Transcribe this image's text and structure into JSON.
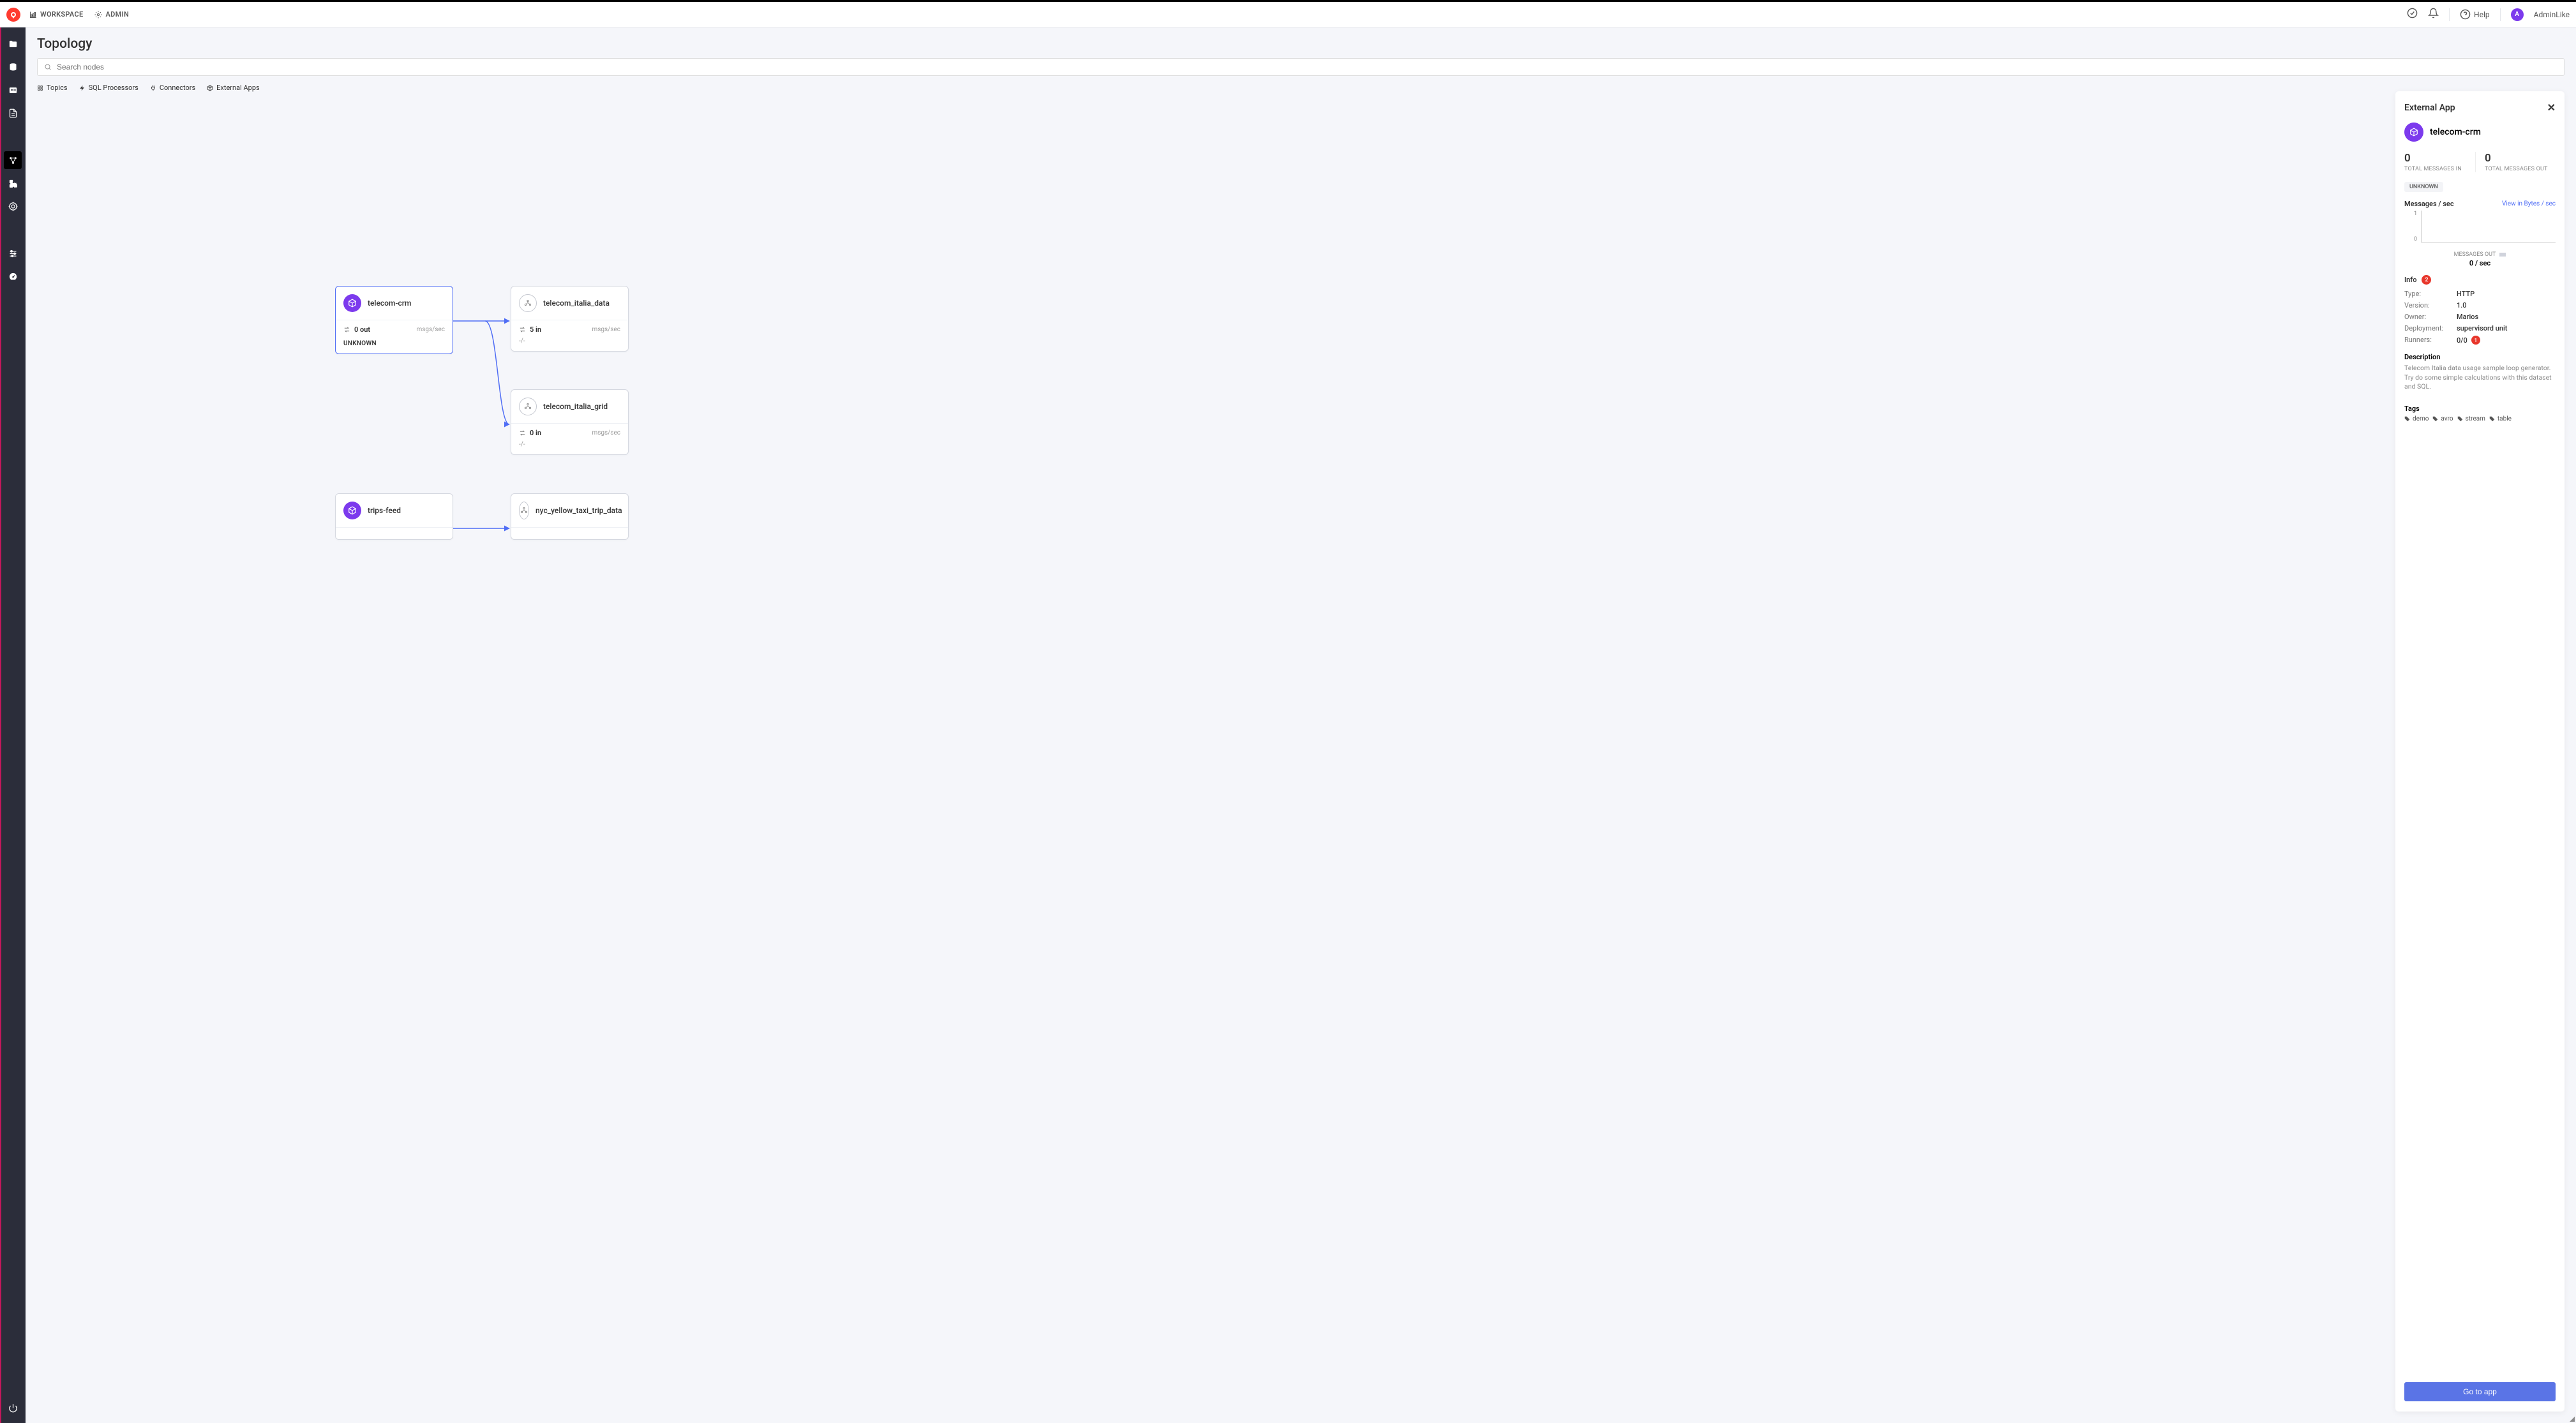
{
  "topnav": {
    "workspace_label": "WORKSPACE",
    "admin_label": "ADMIN",
    "help_label": "Help",
    "user_initial": "A",
    "user_name": "AdminLike"
  },
  "page": {
    "title": "Topology",
    "search_placeholder": "Search nodes"
  },
  "filters": {
    "topics": "Topics",
    "sql": "SQL Processors",
    "connectors": "Connectors",
    "external": "External Apps"
  },
  "nodes": {
    "n1": {
      "title": "telecom-crm",
      "flow": "0 out",
      "rate": "msgs/sec",
      "status": "UNKNOWN"
    },
    "n2": {
      "title": "telecom_italia_data",
      "flow": "5 in",
      "rate": "msgs/sec",
      "sub": "-/-"
    },
    "n3": {
      "title": "telecom_italia_grid",
      "flow": "0 in",
      "rate": "msgs/sec",
      "sub": "-/-"
    },
    "n4": {
      "title": "trips-feed"
    },
    "n5": {
      "title": "nyc_yellow_taxi_trip_data"
    }
  },
  "panel": {
    "header": "External App",
    "name": "telecom-crm",
    "messages_in_value": "0",
    "messages_in_label": "TOTAL MESSAGES IN",
    "messages_out_value": "0",
    "messages_out_label": "TOTAL MESSAGES OUT",
    "status_badge": "UNKNOWN",
    "chart_section": "Messages / sec",
    "view_link": "View in Bytes / sec",
    "chart_y_top": "1",
    "chart_y_bottom": "0",
    "legend": "MESSAGES OUT",
    "rate_value": "0 / sec",
    "info_heading": "Info",
    "info_badge": "2",
    "kv": {
      "type_k": "Type:",
      "type_v": "HTTP",
      "version_k": "Version:",
      "version_v": "1.0",
      "owner_k": "Owner:",
      "owner_v": "Marios",
      "deployment_k": "Deployment:",
      "deployment_v": "supervisord unit",
      "runners_k": "Runners:",
      "runners_v": "0/0",
      "runners_badge": "1"
    },
    "description_heading": "Description",
    "description_text": "Telecom Italia data usage sample loop generator. Try do some simple calculations with this dataset and SQL.",
    "tags_heading": "Tags",
    "tags": {
      "t1": "demo",
      "t2": "avro",
      "t3": "stream",
      "t4": "table"
    },
    "go_button": "Go to app"
  },
  "chart_data": {
    "type": "line",
    "title": "Messages / sec",
    "series": [
      {
        "name": "MESSAGES OUT",
        "values": [
          0,
          0,
          0,
          0,
          0,
          0,
          0,
          0,
          0,
          0
        ]
      }
    ],
    "ylim": [
      0,
      1
    ],
    "xlabel": "",
    "ylabel": ""
  }
}
